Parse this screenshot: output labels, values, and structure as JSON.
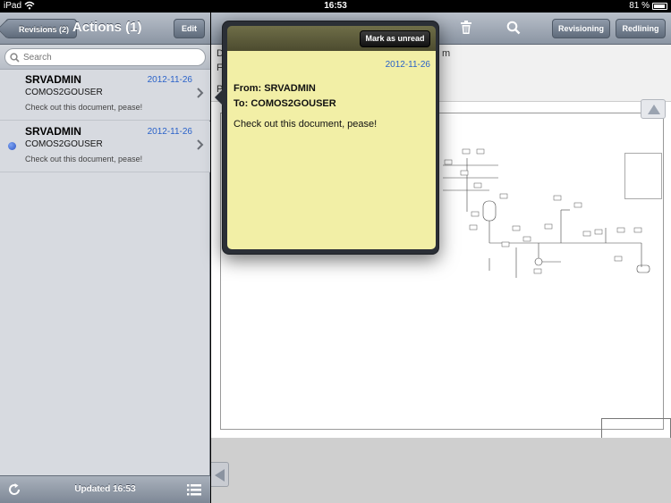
{
  "status_bar": {
    "carrier": "iPad",
    "time": "16:53",
    "battery": "81 %"
  },
  "left_panel": {
    "back_label": "Revisions (2)",
    "title": "Actions (1)",
    "edit_label": "Edit",
    "search_placeholder": "Search",
    "messages": [
      {
        "from": "SRVADMIN",
        "to": "COMOS2GOUSER",
        "date": "2012-11-26",
        "body": "Check out this document, pease!",
        "unread": false
      },
      {
        "from": "SRVADMIN",
        "to": "COMOS2GOUSER",
        "date": "2012-11-26",
        "body": "Check out this document, pease!",
        "unread": true
      }
    ],
    "updated_label": "Updated 16:53"
  },
  "right_panel": {
    "revisioning_label": "Revisioning",
    "redlining_label": "Redlining",
    "info_lines": [
      "D",
      "F",
      "P"
    ],
    "info_tail": "m"
  },
  "popover": {
    "mark_unread_label": "Mark as unread",
    "date": "2012-11-26",
    "from_line": "From: SRVADMIN",
    "to_line": "To: COMOS2GOUSER",
    "body": "Check out this document, pease!"
  },
  "colors": {
    "link_blue": "#2a62c9",
    "note_yellow": "#f2efa6",
    "unread_dot": "#2c55c5"
  }
}
